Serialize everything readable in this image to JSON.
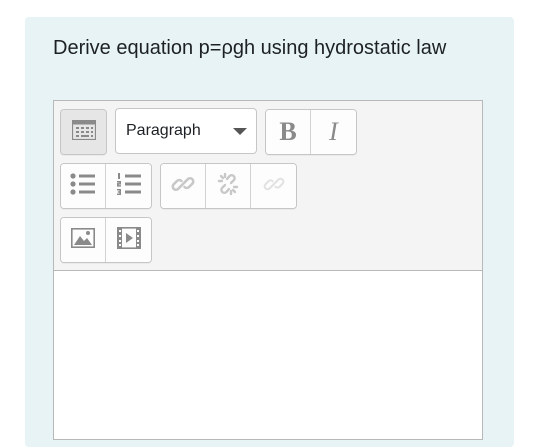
{
  "question": {
    "text": "Derive equation p=ρgh using hydrostatic law"
  },
  "editor": {
    "toolbar": {
      "toggle_icon": "toolbar-toggle-icon",
      "block_format": {
        "selected": "Paragraph"
      },
      "bold_label": "B",
      "italic_label": "I",
      "icons": [
        "unordered-list-icon",
        "ordered-list-icon",
        "link-icon",
        "unlink-icon",
        "autolink-icon",
        "image-icon",
        "media-icon"
      ]
    },
    "content": ""
  },
  "colors": {
    "card_background": "#e7f3f5",
    "toolbar_background": "#f4f4f4",
    "icon_gray": "#8a8a8a",
    "text": "#1d2125"
  }
}
